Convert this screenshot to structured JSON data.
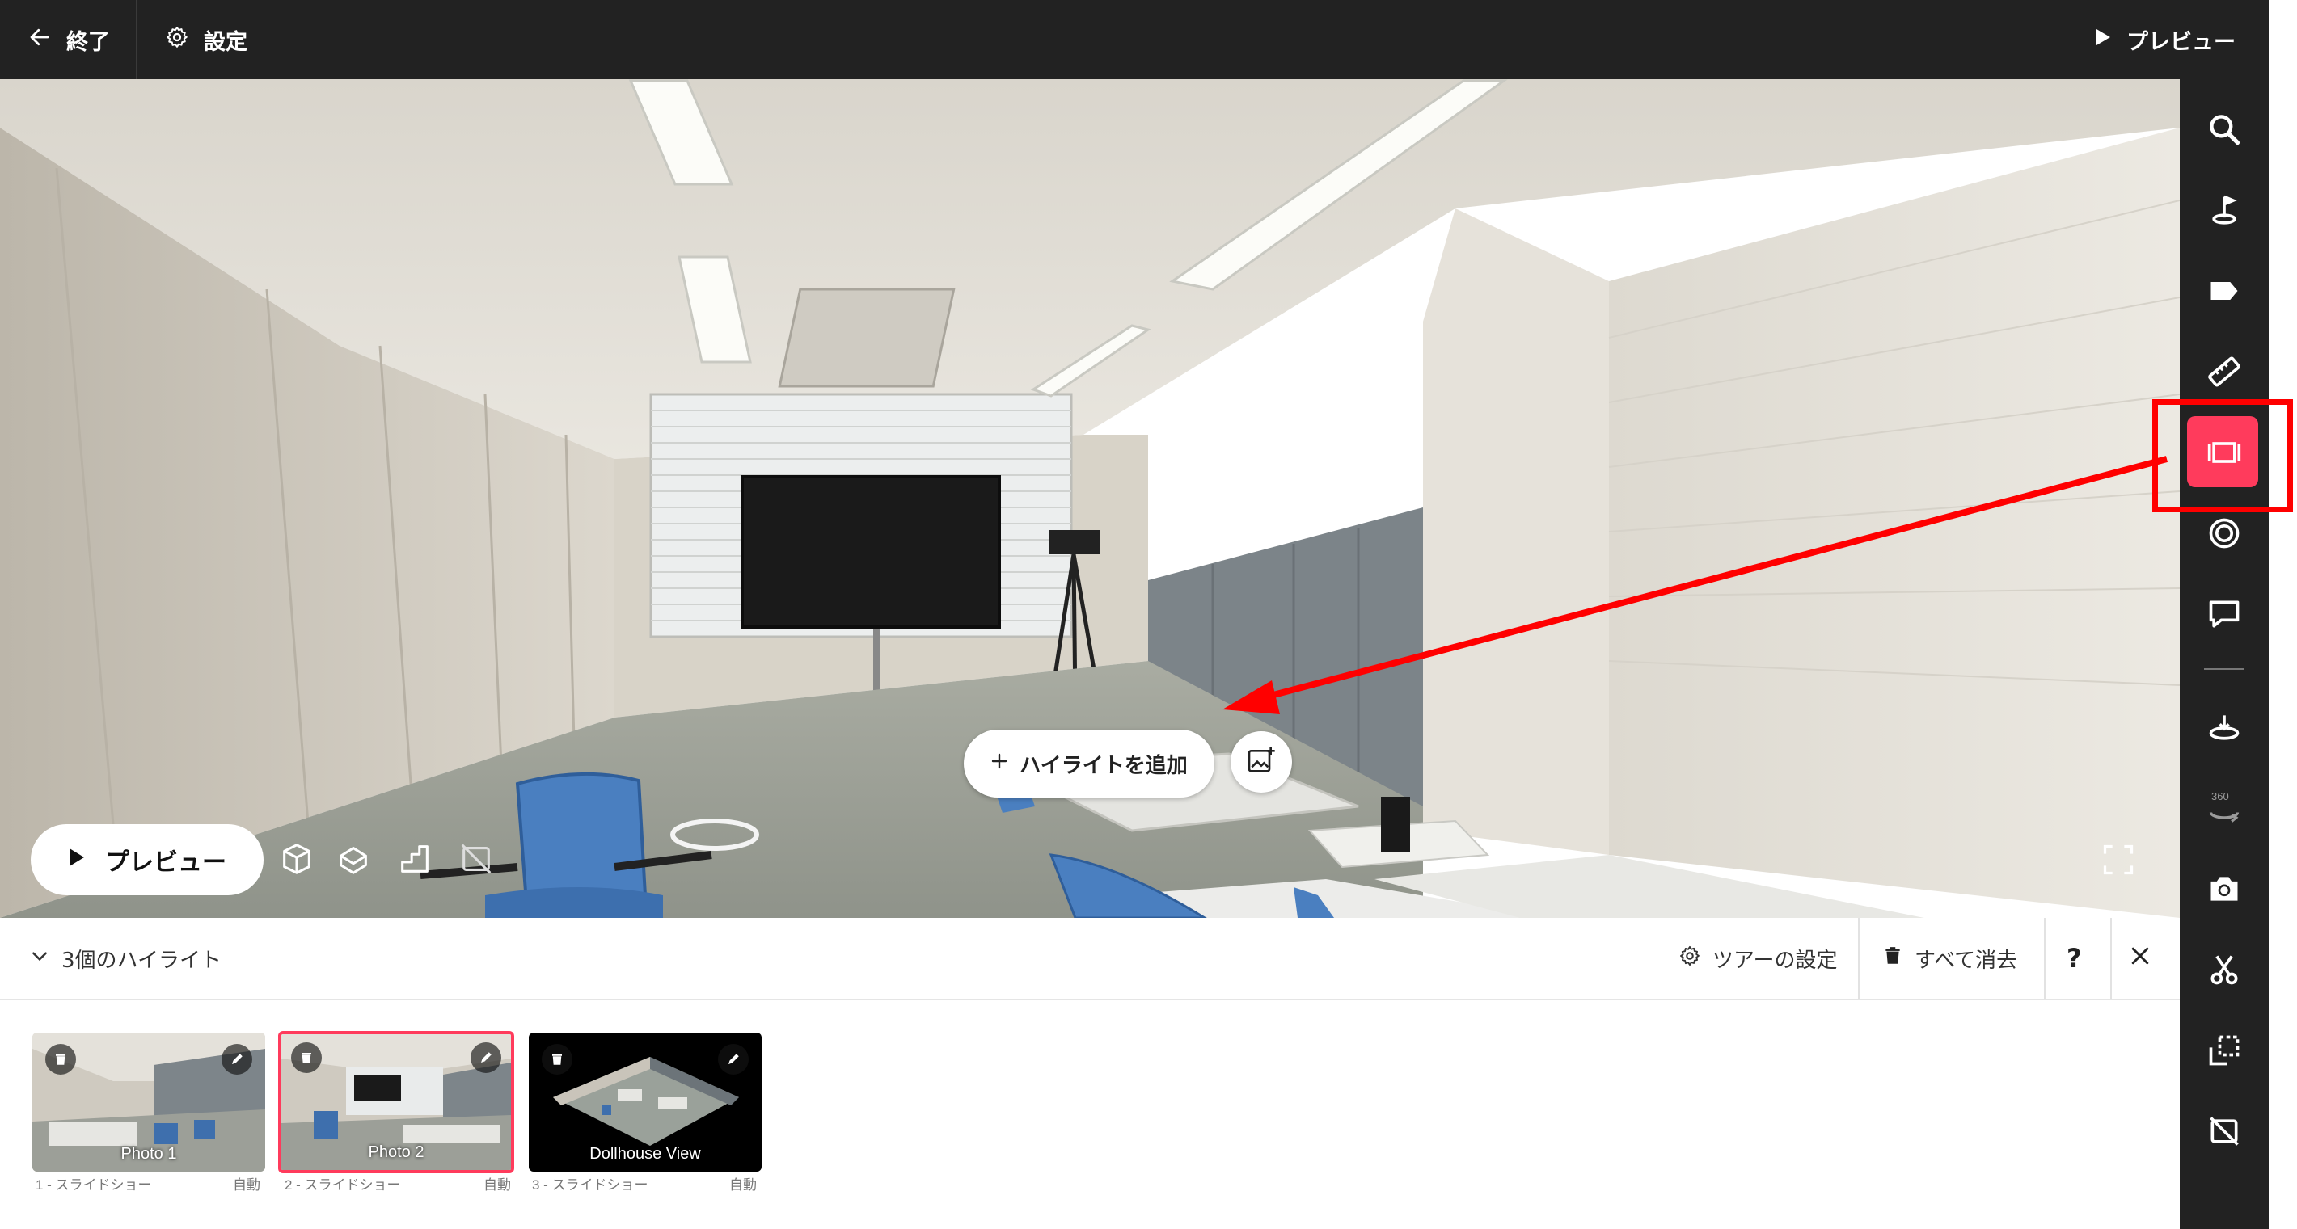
{
  "topbar": {
    "exit_label": "終了",
    "settings_label": "設定",
    "preview_label": "プレビュー"
  },
  "viewport": {
    "preview_button_label": "プレビュー",
    "add_highlight_label": "ハイライトを追加"
  },
  "panel": {
    "highlight_count_label": "3個のハイライト",
    "tour_settings_label": "ツアーの設定",
    "clear_all_label": "すべて消去",
    "help_label": "?",
    "highlights": [
      {
        "title": "Photo 1",
        "caption": "1 - スライドショー",
        "mode": "自動",
        "selected": false
      },
      {
        "title": "Photo 2",
        "caption": "2 - スライドショー",
        "mode": "自動",
        "selected": true
      },
      {
        "title": "Dollhouse View",
        "caption": "3 - スライドショー",
        "mode": "自動",
        "selected": false
      }
    ]
  },
  "right_toolbar": {
    "icons": [
      "search-icon",
      "start-location-icon",
      "tag-icon",
      "measure-icon",
      "highlight-reel-icon",
      "mattertag-icon",
      "comment-icon",
      "floor-icon",
      "360-views-icon",
      "snapshot-icon",
      "trim-icon",
      "labels-icon",
      "hide-icon"
    ],
    "active_icon": "highlight-reel-icon",
    "badge_360": "360"
  },
  "colors": {
    "accent": "#ff3b5c",
    "annotation_red": "#ff0000",
    "bar_dark": "#222222"
  }
}
